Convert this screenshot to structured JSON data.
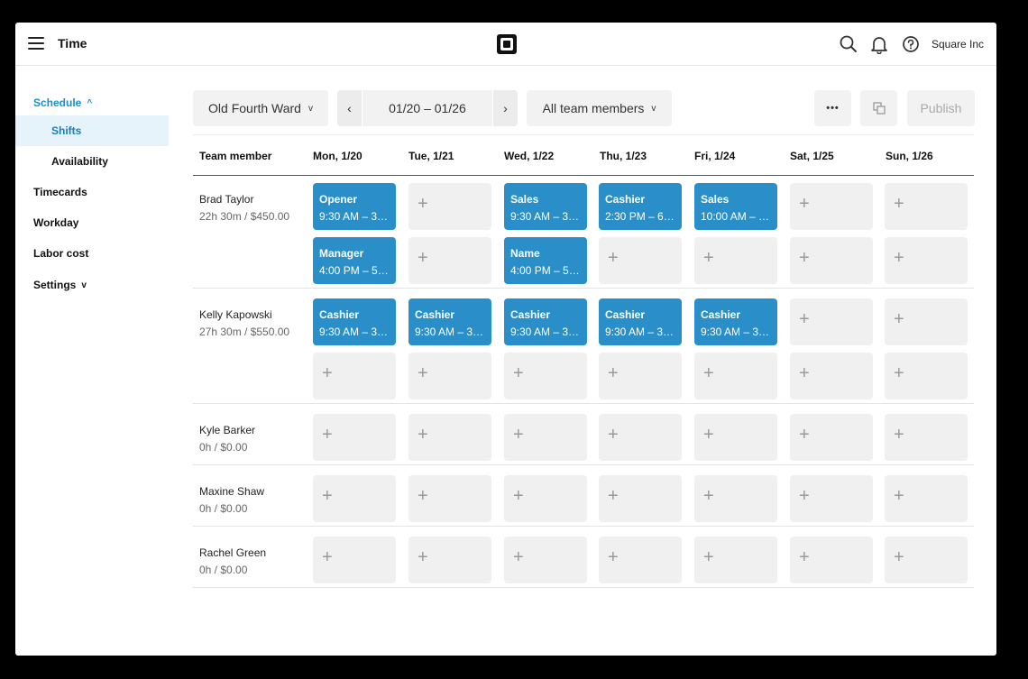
{
  "header": {
    "app_title": "Time",
    "org_name": "Square Inc",
    "icons": [
      "menu-icon",
      "square-logo",
      "search-icon",
      "bell-icon",
      "help-icon"
    ]
  },
  "sidebar": {
    "items": [
      {
        "label": "Schedule",
        "expanded": true
      },
      {
        "label": "Shifts",
        "selected": true
      },
      {
        "label": "Availability"
      },
      {
        "label": "Timecards"
      },
      {
        "label": "Workday"
      },
      {
        "label": "Labor cost"
      },
      {
        "label": "Settings",
        "expanded": false
      }
    ]
  },
  "toolbar": {
    "location": "Old Fourth Ward",
    "date_range": "01/20 – 01/26",
    "team_filter": "All team members",
    "more_label": "•••",
    "publish_label": "Publish"
  },
  "grid": {
    "member_header": "Team member",
    "days": [
      "Mon, 1/20",
      "Tue, 1/21",
      "Wed, 1/22",
      "Thu, 1/23",
      "Fri, 1/24",
      "Sat, 1/25",
      "Sun, 1/26"
    ],
    "members": [
      {
        "name": "Brad Taylor",
        "summary": "22h 30m / $450.00",
        "rows": [
          [
            {
              "role": "Opener",
              "time": "9:30 AM – 3…"
            },
            null,
            {
              "role": "Sales",
              "time": "9:30 AM – 3…"
            },
            {
              "role": "Cashier",
              "time": "2:30 PM – 6…"
            },
            {
              "role": "Sales",
              "time": "10:00 AM – …"
            },
            null,
            null
          ],
          [
            {
              "role": "Manager",
              "time": "4:00 PM – 5…"
            },
            null,
            {
              "role": "Name",
              "time": "4:00 PM – 5…"
            },
            null,
            null,
            null,
            null
          ]
        ]
      },
      {
        "name": "Kelly Kapowski",
        "summary": "27h 30m / $550.00",
        "rows": [
          [
            {
              "role": "Cashier",
              "time": "9:30 AM – 3…"
            },
            {
              "role": "Cashier",
              "time": "9:30 AM – 3…"
            },
            {
              "role": "Cashier",
              "time": "9:30 AM – 3…"
            },
            {
              "role": "Cashier",
              "time": "9:30 AM – 3…"
            },
            {
              "role": "Cashier",
              "time": "9:30 AM – 3…"
            },
            null,
            null
          ],
          [
            null,
            null,
            null,
            null,
            null,
            null,
            null
          ]
        ]
      },
      {
        "name": "Kyle Barker",
        "summary": "0h / $0.00",
        "rows": [
          [
            null,
            null,
            null,
            null,
            null,
            null,
            null
          ]
        ]
      },
      {
        "name": "Maxine Shaw",
        "summary": "0h / $0.00",
        "rows": [
          [
            null,
            null,
            null,
            null,
            null,
            null,
            null
          ]
        ]
      },
      {
        "name": "Rachel Green",
        "summary": "0h / $0.00",
        "rows": [
          [
            null,
            null,
            null,
            null,
            null,
            null,
            null
          ]
        ]
      }
    ]
  },
  "colors": {
    "accent": "#2a8fc9",
    "selected_bg": "#e6f3fb",
    "empty_cell": "#f0f0f0"
  }
}
